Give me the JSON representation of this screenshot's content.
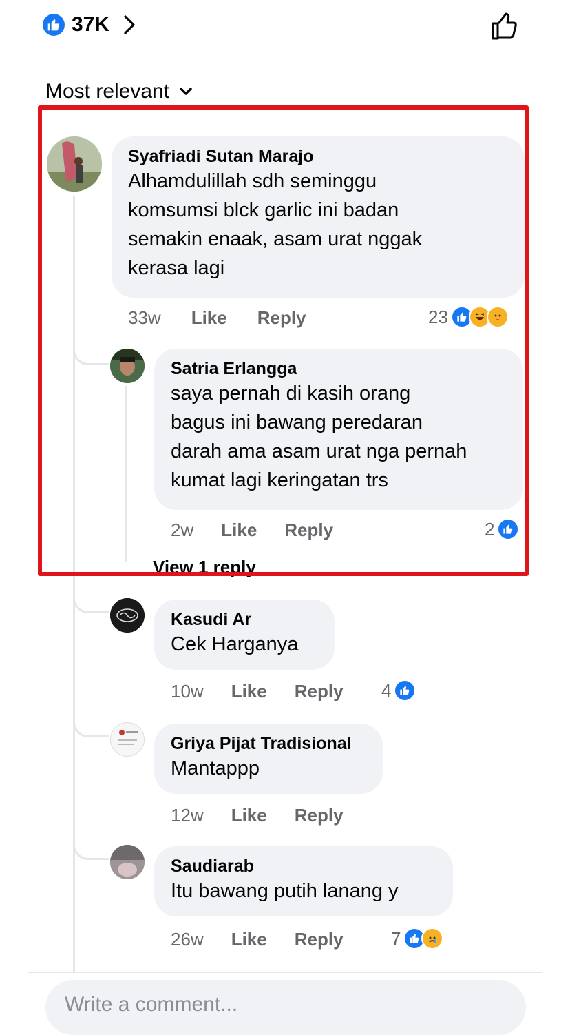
{
  "header": {
    "reaction_count": "37K",
    "sort_label": "Most relevant"
  },
  "comments": [
    {
      "author": "Syafriadi Sutan Marajo",
      "lines": [
        "Alhamdulillah sdh seminggu",
        "komsumsi blck garlic ini badan",
        "semakin enaak, asam urat nggak",
        "kerasa lagi"
      ],
      "time": "33w",
      "like_label": "Like",
      "reply_label": "Reply",
      "reaction_count": "23"
    },
    {
      "author": "Satria Erlangga",
      "lines": [
        "saya pernah di kasih orang",
        "bagus ini bawang peredaran",
        "darah ama asam urat nga pernah",
        "kumat lagi keringatan trs"
      ],
      "time": "2w",
      "like_label": "Like",
      "reply_label": "Reply",
      "reaction_count": "2"
    },
    {
      "author": "Kasudi Ar",
      "lines": [
        "Cek Harganya"
      ],
      "time": "10w",
      "like_label": "Like",
      "reply_label": "Reply",
      "reaction_count": "4"
    },
    {
      "author": "Griya Pijat Tradisional",
      "lines": [
        "Mantappp"
      ],
      "time": "12w",
      "like_label": "Like",
      "reply_label": "Reply"
    },
    {
      "author": "Saudiarab",
      "lines": [
        "Itu bawang putih lanang y"
      ],
      "time": "26w",
      "like_label": "Like",
      "reply_label": "Reply",
      "reaction_count": "7"
    }
  ],
  "view_replies": "View 1 reply",
  "composer": {
    "placeholder": "Write a comment..."
  },
  "colors": {
    "highlight": "#e0141b",
    "like_blue": "#1877f2",
    "bubble": "#f0f2f5",
    "secondary_text": "#65676b"
  }
}
